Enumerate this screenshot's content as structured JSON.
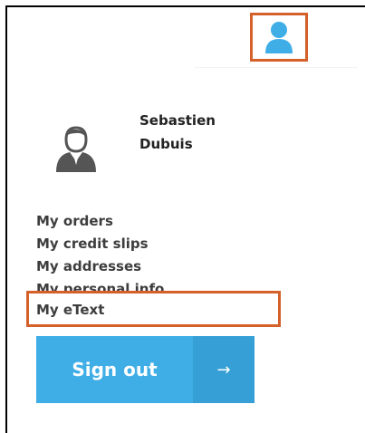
{
  "header": {
    "account_icon": "user-icon",
    "accent_color": "#3faee6",
    "highlight_color": "#d4602a"
  },
  "user": {
    "first_name": "Sebastien",
    "last_name": "Dubuis",
    "avatar_icon": "user-avatar-icon"
  },
  "menu": {
    "items": [
      {
        "label": "My orders"
      },
      {
        "label": "My credit slips"
      },
      {
        "label": "My addresses"
      },
      {
        "label": "My personal info"
      },
      {
        "label": "My eText"
      }
    ]
  },
  "signout": {
    "label": "Sign out",
    "arrow": "→"
  }
}
